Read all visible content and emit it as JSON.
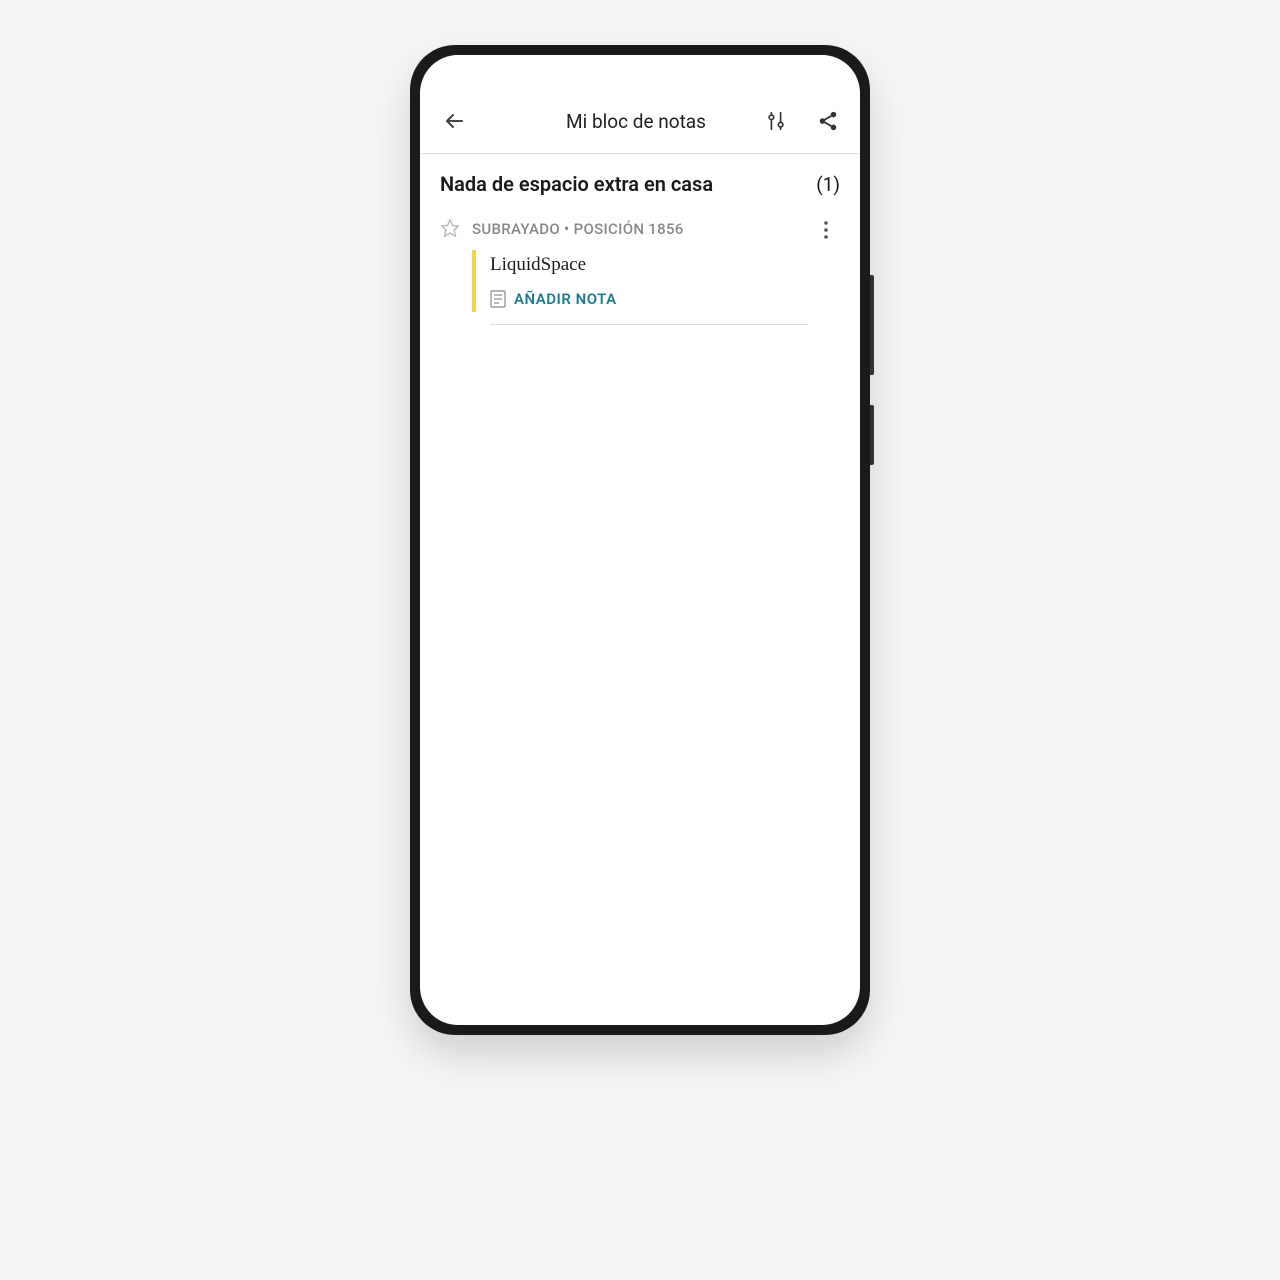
{
  "header": {
    "title": "Mi bloc de notas"
  },
  "section": {
    "title": "Nada de espacio extra en casa",
    "count": "(1)"
  },
  "highlight": {
    "type": "SUBRAYADO",
    "separator": " • ",
    "position": "POSICIÓN 1856",
    "text": "LiquidSpace",
    "add_note_label": "AÑADIR NOTA"
  },
  "colors": {
    "highlight_bar": "#f5d547",
    "link": "#1e7a8c"
  }
}
